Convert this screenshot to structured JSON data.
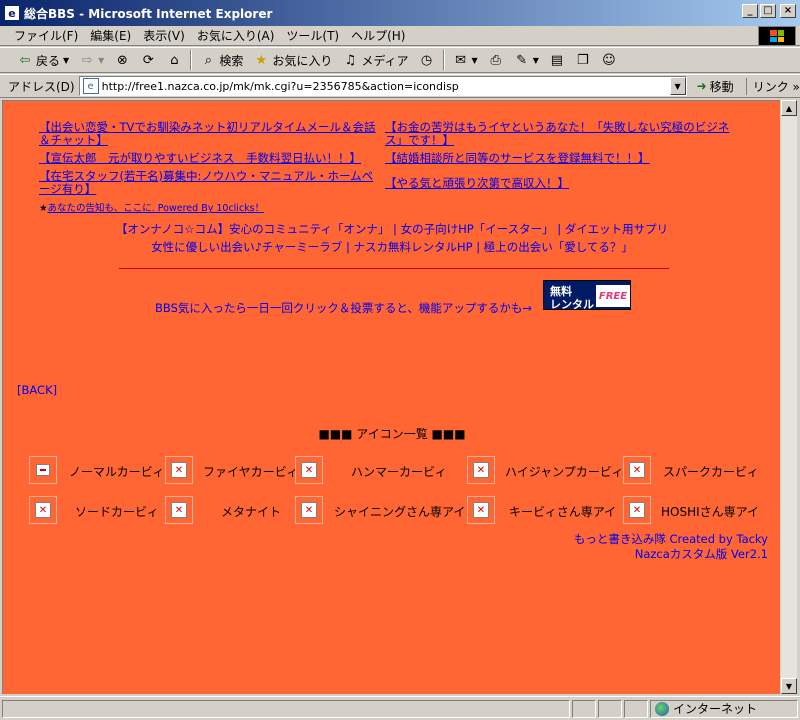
{
  "window": {
    "title": "総合BBS - Microsoft Internet Explorer",
    "buttons": {
      "minimize": "_",
      "maximize": "□",
      "close": "×"
    }
  },
  "menu": [
    "ファイル(F)",
    "編集(E)",
    "表示(V)",
    "お気に入り(A)",
    "ツール(T)",
    "ヘルプ(H)"
  ],
  "toolbar": {
    "back": "戻る",
    "search": "検索",
    "favorites": "お気に入り",
    "media": "メディア"
  },
  "address": {
    "label": "アドレス(D)",
    "url": "http://free1.nazca.co.jp/mk/mk.cgi?u=2356785&action=icondisp",
    "go": "移動",
    "links": "リンク"
  },
  "ads": {
    "left": [
      "【出会い恋愛・TVでお馴染みネット初リアルタイムメール＆会話＆チャット】",
      "【宣伝太郎　元が取りやすいビジネス　手数料翌日払い！！】",
      "【在宅スタッフ(若干名)募集中:ノウハウ・マニュアル・ホームページ有り】"
    ],
    "right": [
      "【お金の苦労はもうイヤというあなた！「失敗しない究極のビジネス」です！】",
      "【結婚相談所と同等のサービスを登録無料で！！】",
      "【やる気と頑張り次第で高収入！】"
    ],
    "small_star": "★",
    "small_text": "あなたの告知も、ここに. Powered By 10clicks！"
  },
  "promo": {
    "line1": "【オンナノコ☆コム】安心のコミュニティ「オンナ」 | 女の子向けHP「イースター」 | ダイエット用サプリ",
    "line2": "女性に優しい出会い♪チャーミーラブ | ナスカ無料レンタルHP | 極上の出会い「愛してる？」"
  },
  "bbs_vote": "BBS気に入ったら一日一回クリック＆投票すると、機能アップするかも→",
  "rental_banner": {
    "line1": "無料",
    "line2": "レンタル",
    "free": "FREE"
  },
  "back_link": "[BACK]",
  "icon_heading": "■■■ アイコン一覧 ■■■",
  "icons": [
    "ノーマルカービィ",
    "ファイヤカービィ",
    "ハンマーカービィ",
    "ハイジャンプカービィ",
    "スパークカービィ",
    "ソードカービィ",
    "メタナイト",
    "シャイニングさん専アイ",
    "キービィさん専アイ",
    "HOSHIさん専アイ"
  ],
  "credit": {
    "line1": "もっと書き込み隊 Created by Tacky",
    "line2": "Nazcaカスタム版 Ver2.1"
  },
  "status": {
    "zone": "インターネット"
  }
}
